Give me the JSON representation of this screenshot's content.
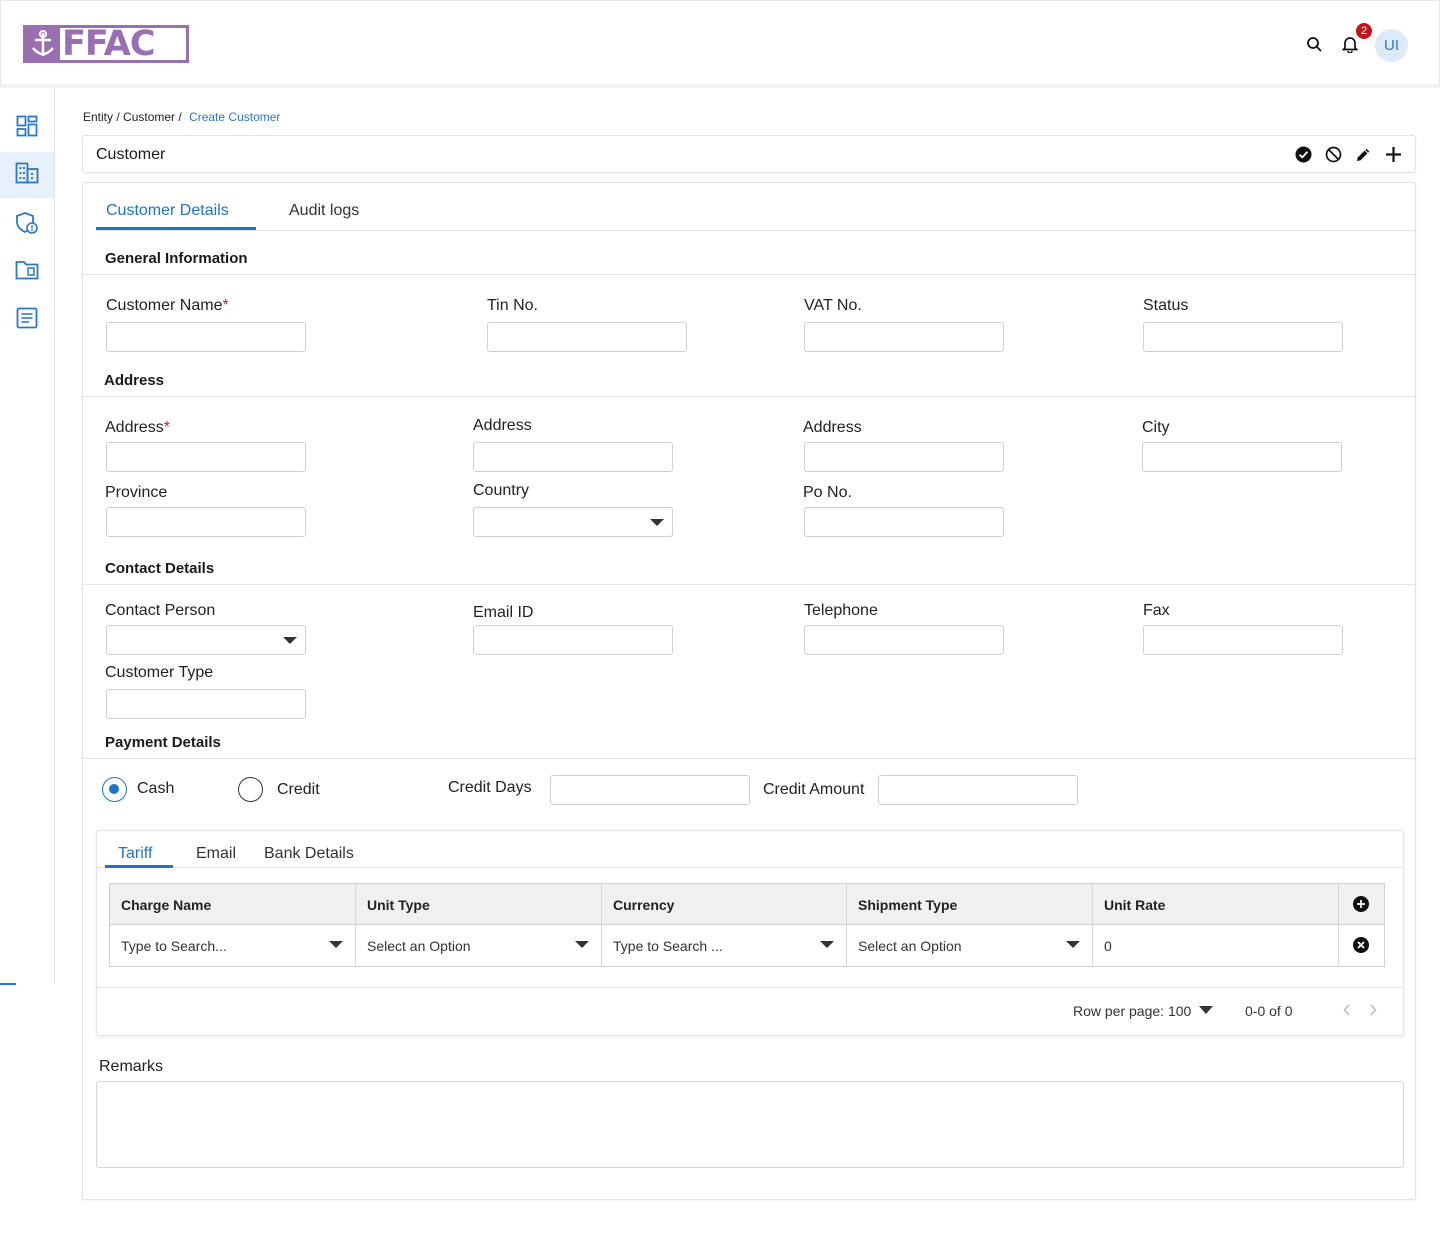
{
  "app": {
    "logo_text": "FFAC",
    "notification_count": "2",
    "user_initials": "UI"
  },
  "breadcrumb": {
    "items": [
      "Entity /",
      "Customer /"
    ],
    "current": "Create Customer"
  },
  "page": {
    "title": "Customer"
  },
  "tabs": [
    "Customer Details",
    "Audit logs"
  ],
  "general": {
    "title": "General Information",
    "customer_name": "Customer Name",
    "tin": "Tin No.",
    "vat": "VAT No.",
    "status": "Status"
  },
  "address": {
    "title": "Address",
    "address1": "Address",
    "address2": "Address",
    "address3": "Address",
    "city": "City",
    "province": "Province",
    "country": "Country",
    "po": "Po No."
  },
  "contact": {
    "title": "Contact Details",
    "person": "Contact Person",
    "email": "Email ID",
    "telephone": "Telephone",
    "fax": "Fax",
    "customer_type": "Customer Type"
  },
  "payment": {
    "title": "Payment Details",
    "cash": "Cash",
    "credit": "Credit",
    "credit_days": "Credit Days",
    "credit_amount": "Credit Amount",
    "selected": "Cash"
  },
  "subtabs": [
    "Tariff",
    "Email",
    "Bank Details"
  ],
  "tariff": {
    "columns": [
      "Charge Name",
      "Unit Type",
      "Currency",
      "Shipment Type",
      "Unit Rate"
    ],
    "row": [
      "Type to Search...",
      "Select an Option",
      "Type to Search ...",
      "Select an Option",
      "0"
    ]
  },
  "pager": {
    "rows_per_page": "Row per page: 100",
    "range": "0-0 of 0"
  },
  "remarks": {
    "label": "Remarks"
  },
  "colors": {
    "accent": "#1f74c8",
    "brand": "#9a6fb2",
    "required": "#c81e1e",
    "badge": "#c0161a"
  }
}
